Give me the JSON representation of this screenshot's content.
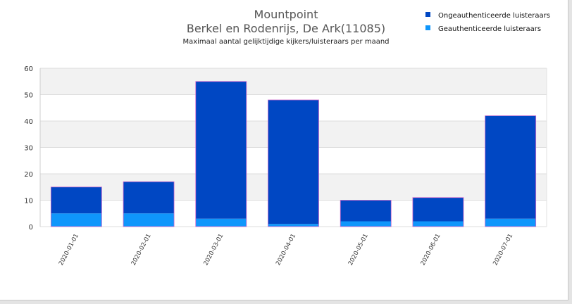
{
  "chart_data": {
    "type": "bar",
    "stacked": true,
    "title": "Mountpoint",
    "subtitle": "Berkel en Rodenrijs, De Ark(11085)",
    "description": "Maximaal aantal gelijktijdige kijkers/luisteraars per maand",
    "xlabel": "",
    "ylabel": "",
    "categories": [
      "2020-01-01",
      "2020-02-01",
      "2020-03-01",
      "2020-04-01",
      "2020-05-01",
      "2020-06-01",
      "2020-07-01"
    ],
    "series": [
      {
        "name": "Geauthenticeerde luisteraars",
        "values": [
          5,
          5,
          3,
          1,
          2,
          2,
          3
        ],
        "color": "#0f96fb"
      },
      {
        "name": "Ongeauthenticeerde luisteraars",
        "values": [
          10,
          12,
          52,
          47,
          8,
          9,
          39
        ],
        "color": "#0047c3"
      }
    ],
    "legend_order": [
      "Ongeauthenticeerde luisteraars",
      "Geauthenticeerde luisteraars"
    ],
    "ylim": [
      0,
      60
    ],
    "yticks": [
      0,
      10,
      20,
      30,
      40,
      50,
      60
    ],
    "grid": true,
    "band_colors": [
      "#ffffff",
      "#f2f2f2"
    ],
    "bar_outline_color": "#cc66cc",
    "legend_position": "top-right"
  }
}
